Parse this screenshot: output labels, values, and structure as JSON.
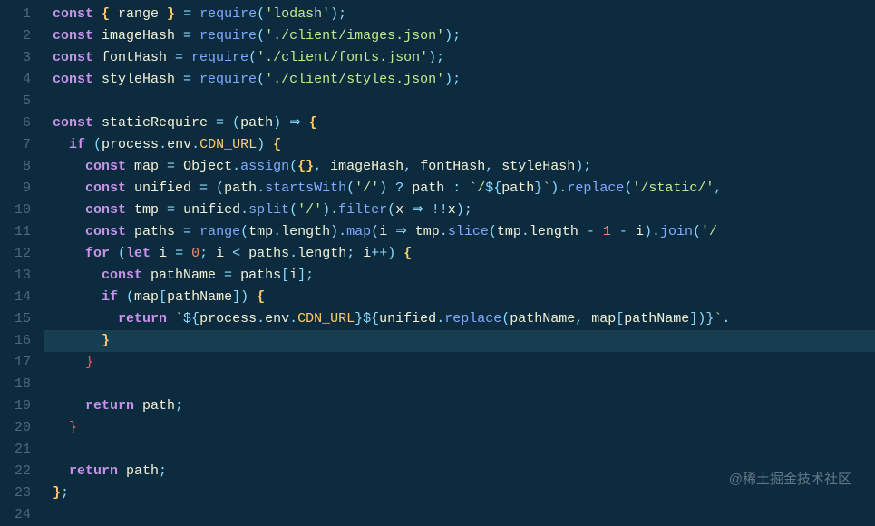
{
  "watermark": "@稀土掘金技术社区",
  "total_lines": 24,
  "highlighted_line": 16,
  "lines": [
    {
      "n": 1,
      "tokens": [
        [
          "kw",
          "const "
        ],
        [
          "pb",
          "{ "
        ],
        [
          "var",
          "range"
        ],
        [
          "pb",
          " }"
        ],
        [
          "op",
          " = "
        ],
        [
          "fn",
          "require"
        ],
        [
          "op",
          "("
        ],
        [
          "str",
          "'lodash'"
        ],
        [
          "op",
          ");"
        ]
      ]
    },
    {
      "n": 2,
      "tokens": [
        [
          "kw",
          "const "
        ],
        [
          "var",
          "imageHash"
        ],
        [
          "op",
          " = "
        ],
        [
          "fn",
          "require"
        ],
        [
          "op",
          "("
        ],
        [
          "str",
          "'./client/images.json'"
        ],
        [
          "op",
          ");"
        ]
      ]
    },
    {
      "n": 3,
      "tokens": [
        [
          "kw",
          "const "
        ],
        [
          "var",
          "fontHash"
        ],
        [
          "op",
          " = "
        ],
        [
          "fn",
          "require"
        ],
        [
          "op",
          "("
        ],
        [
          "str",
          "'./client/fonts.json'"
        ],
        [
          "op",
          ");"
        ]
      ]
    },
    {
      "n": 4,
      "tokens": [
        [
          "kw",
          "const "
        ],
        [
          "var",
          "styleHash"
        ],
        [
          "op",
          " = "
        ],
        [
          "fn",
          "require"
        ],
        [
          "op",
          "("
        ],
        [
          "str",
          "'./client/styles.json'"
        ],
        [
          "op",
          ");"
        ]
      ]
    },
    {
      "n": 5,
      "tokens": []
    },
    {
      "n": 6,
      "tokens": [
        [
          "kw",
          "const "
        ],
        [
          "var",
          "staticRequire"
        ],
        [
          "op",
          " = ("
        ],
        [
          "var",
          "path"
        ],
        [
          "op",
          ") "
        ],
        [
          "op",
          "⇒"
        ],
        [
          "op",
          " "
        ],
        [
          "pb",
          "{"
        ]
      ]
    },
    {
      "n": 7,
      "tokens": [
        [
          "",
          "  "
        ],
        [
          "kw",
          "if "
        ],
        [
          "op",
          "("
        ],
        [
          "var",
          "process"
        ],
        [
          "op",
          "."
        ],
        [
          "var",
          "env"
        ],
        [
          "op",
          "."
        ],
        [
          "acc",
          "CDN_URL"
        ],
        [
          "op",
          ") "
        ],
        [
          "pb",
          "{"
        ]
      ]
    },
    {
      "n": 8,
      "tokens": [
        [
          "",
          "    "
        ],
        [
          "kw",
          "const "
        ],
        [
          "var",
          "map"
        ],
        [
          "op",
          " = "
        ],
        [
          "var",
          "Object"
        ],
        [
          "op",
          "."
        ],
        [
          "fn",
          "assign"
        ],
        [
          "op",
          "("
        ],
        [
          "pb",
          "{}"
        ],
        [
          "op",
          ", "
        ],
        [
          "var",
          "imageHash"
        ],
        [
          "op",
          ", "
        ],
        [
          "var",
          "fontHash"
        ],
        [
          "op",
          ", "
        ],
        [
          "var",
          "styleHash"
        ],
        [
          "op",
          ");"
        ]
      ]
    },
    {
      "n": 9,
      "tokens": [
        [
          "",
          "    "
        ],
        [
          "kw",
          "const "
        ],
        [
          "var",
          "unified"
        ],
        [
          "op",
          " = ("
        ],
        [
          "var",
          "path"
        ],
        [
          "op",
          "."
        ],
        [
          "fn",
          "startsWith"
        ],
        [
          "op",
          "("
        ],
        [
          "str",
          "'/'"
        ],
        [
          "op",
          ") "
        ],
        [
          "op",
          "?"
        ],
        [
          "op",
          " "
        ],
        [
          "var",
          "path"
        ],
        [
          "op",
          " : "
        ],
        [
          "tmpl",
          "`/"
        ],
        [
          "op",
          "${"
        ],
        [
          "tvar",
          "path"
        ],
        [
          "op",
          "}"
        ],
        [
          "tmpl",
          "`"
        ],
        [
          "op",
          ")."
        ],
        [
          "fn",
          "replace"
        ],
        [
          "op",
          "("
        ],
        [
          "str",
          "'/static/'"
        ],
        [
          "op",
          ","
        ]
      ]
    },
    {
      "n": 10,
      "tokens": [
        [
          "",
          "    "
        ],
        [
          "kw",
          "const "
        ],
        [
          "var",
          "tmp"
        ],
        [
          "op",
          " = "
        ],
        [
          "var",
          "unified"
        ],
        [
          "op",
          "."
        ],
        [
          "fn",
          "split"
        ],
        [
          "op",
          "("
        ],
        [
          "str",
          "'/'"
        ],
        [
          "op",
          ")."
        ],
        [
          "fn",
          "filter"
        ],
        [
          "op",
          "("
        ],
        [
          "var",
          "x"
        ],
        [
          "op",
          " ⇒ "
        ],
        [
          "op",
          "!!"
        ],
        [
          "var",
          "x"
        ],
        [
          "op",
          ");"
        ]
      ]
    },
    {
      "n": 11,
      "tokens": [
        [
          "",
          "    "
        ],
        [
          "kw",
          "const "
        ],
        [
          "var",
          "paths"
        ],
        [
          "op",
          " = "
        ],
        [
          "fn",
          "range"
        ],
        [
          "op",
          "("
        ],
        [
          "var",
          "tmp"
        ],
        [
          "op",
          "."
        ],
        [
          "var",
          "length"
        ],
        [
          "op",
          ")."
        ],
        [
          "fn",
          "map"
        ],
        [
          "op",
          "("
        ],
        [
          "var",
          "i"
        ],
        [
          "op",
          " ⇒ "
        ],
        [
          "var",
          "tmp"
        ],
        [
          "op",
          "."
        ],
        [
          "fn",
          "slice"
        ],
        [
          "op",
          "("
        ],
        [
          "var",
          "tmp"
        ],
        [
          "op",
          "."
        ],
        [
          "var",
          "length"
        ],
        [
          "op",
          " - "
        ],
        [
          "num",
          "1"
        ],
        [
          "op",
          " - "
        ],
        [
          "var",
          "i"
        ],
        [
          "op",
          ")."
        ],
        [
          "fn",
          "join"
        ],
        [
          "op",
          "("
        ],
        [
          "str",
          "'/"
        ]
      ]
    },
    {
      "n": 12,
      "tokens": [
        [
          "",
          "    "
        ],
        [
          "kw",
          "for "
        ],
        [
          "op",
          "("
        ],
        [
          "kw",
          "let "
        ],
        [
          "var",
          "i"
        ],
        [
          "op",
          " = "
        ],
        [
          "num",
          "0"
        ],
        [
          "op",
          "; "
        ],
        [
          "var",
          "i"
        ],
        [
          "op",
          " < "
        ],
        [
          "var",
          "paths"
        ],
        [
          "op",
          "."
        ],
        [
          "var",
          "length"
        ],
        [
          "op",
          "; "
        ],
        [
          "var",
          "i"
        ],
        [
          "op",
          "++) "
        ],
        [
          "pb",
          "{"
        ]
      ]
    },
    {
      "n": 13,
      "tokens": [
        [
          "",
          "      "
        ],
        [
          "kw",
          "const "
        ],
        [
          "var",
          "pathName"
        ],
        [
          "op",
          " = "
        ],
        [
          "var",
          "paths"
        ],
        [
          "op",
          "["
        ],
        [
          "var",
          "i"
        ],
        [
          "op",
          "];"
        ]
      ]
    },
    {
      "n": 14,
      "tokens": [
        [
          "",
          "      "
        ],
        [
          "kw",
          "if "
        ],
        [
          "op",
          "("
        ],
        [
          "var",
          "map"
        ],
        [
          "op",
          "["
        ],
        [
          "var",
          "pathName"
        ],
        [
          "op",
          "]) "
        ],
        [
          "pb",
          "{"
        ]
      ]
    },
    {
      "n": 15,
      "tokens": [
        [
          "",
          "        "
        ],
        [
          "kw",
          "return "
        ],
        [
          "tmpl",
          "`"
        ],
        [
          "op",
          "${"
        ],
        [
          "tvar",
          "process"
        ],
        [
          "op",
          "."
        ],
        [
          "tvar",
          "env"
        ],
        [
          "op",
          "."
        ],
        [
          "acc",
          "CDN_URL"
        ],
        [
          "op",
          "}"
        ],
        [
          "op",
          "${"
        ],
        [
          "tvar",
          "unified"
        ],
        [
          "op",
          "."
        ],
        [
          "fn",
          "replace"
        ],
        [
          "op",
          "("
        ],
        [
          "tvar",
          "pathName"
        ],
        [
          "op",
          ", "
        ],
        [
          "tvar",
          "map"
        ],
        [
          "op",
          "["
        ],
        [
          "tvar",
          "pathName"
        ],
        [
          "op",
          "])"
        ],
        [
          "op",
          "}"
        ],
        [
          "tmpl",
          "`"
        ],
        [
          "op",
          "."
        ]
      ]
    },
    {
      "n": 16,
      "tokens": [
        [
          "",
          "      "
        ],
        [
          "pb",
          "}"
        ]
      ]
    },
    {
      "n": 17,
      "tokens": [
        [
          "",
          "    "
        ],
        [
          "pg",
          "}"
        ]
      ]
    },
    {
      "n": 18,
      "tokens": []
    },
    {
      "n": 19,
      "tokens": [
        [
          "",
          "    "
        ],
        [
          "kw",
          "return "
        ],
        [
          "var",
          "path"
        ],
        [
          "op",
          ";"
        ]
      ]
    },
    {
      "n": 20,
      "tokens": [
        [
          "",
          "  "
        ],
        [
          "pg",
          "}"
        ]
      ]
    },
    {
      "n": 21,
      "tokens": []
    },
    {
      "n": 22,
      "tokens": [
        [
          "",
          "  "
        ],
        [
          "kw",
          "return "
        ],
        [
          "var",
          "path"
        ],
        [
          "op",
          ";"
        ]
      ]
    },
    {
      "n": 23,
      "tokens": [
        [
          "pb",
          "}"
        ],
        [
          "op",
          ";"
        ]
      ]
    },
    {
      "n": 24,
      "tokens": []
    }
  ]
}
